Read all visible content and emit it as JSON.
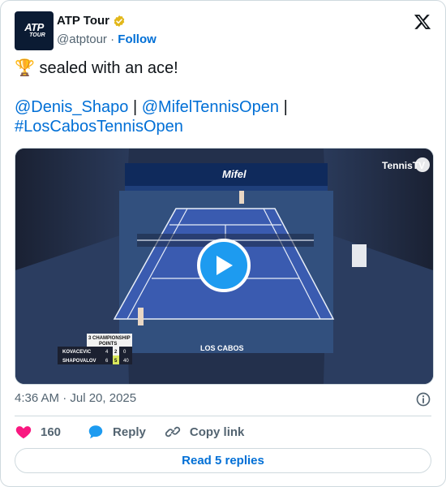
{
  "author": {
    "display_name": "ATP Tour",
    "handle": "@atptour",
    "separator": "·",
    "follow_label": "Follow",
    "avatar_text_line1": "ATP",
    "avatar_text_line2": "TOUR",
    "verified_color": "#e2b719"
  },
  "tweet": {
    "line1": "🏆 sealed with an ace!",
    "mention1": "@Denis_Shapo",
    "pipe": "|",
    "mention2": "@MifelTennisOpen",
    "hashtag": "#LosCabosTennisOpen"
  },
  "video": {
    "watermark": "TennisTV",
    "court_text": "LOS CABOS",
    "banner_text": "Mifel",
    "scoreboard": {
      "title_line1": "3 CHAMPIONSHIP",
      "title_line2": "POINTS",
      "players": [
        {
          "name": "KOVACEVIC",
          "sets": "4",
          "games": "2",
          "points": "0"
        },
        {
          "name": "SHAPOVALOV",
          "sets": "6",
          "games": "5",
          "points": "40"
        }
      ]
    }
  },
  "meta": {
    "timestamp": "4:36 AM · Jul 20, 2025"
  },
  "actions": {
    "like_count": "160",
    "reply_label": "Reply",
    "copy_label": "Copy link"
  },
  "footer": {
    "read_replies_label": "Read 5 replies"
  },
  "colors": {
    "link": "#006fd6",
    "like": "#f91880",
    "reply_icon": "#1d9bf0",
    "court": "#3a5bb0",
    "court_surround": "#32507e"
  },
  "icons": [
    "verified-badge-icon",
    "x-logo-icon",
    "trophy-emoji",
    "play-icon",
    "info-icon",
    "heart-icon",
    "reply-bubble-icon",
    "link-icon"
  ]
}
